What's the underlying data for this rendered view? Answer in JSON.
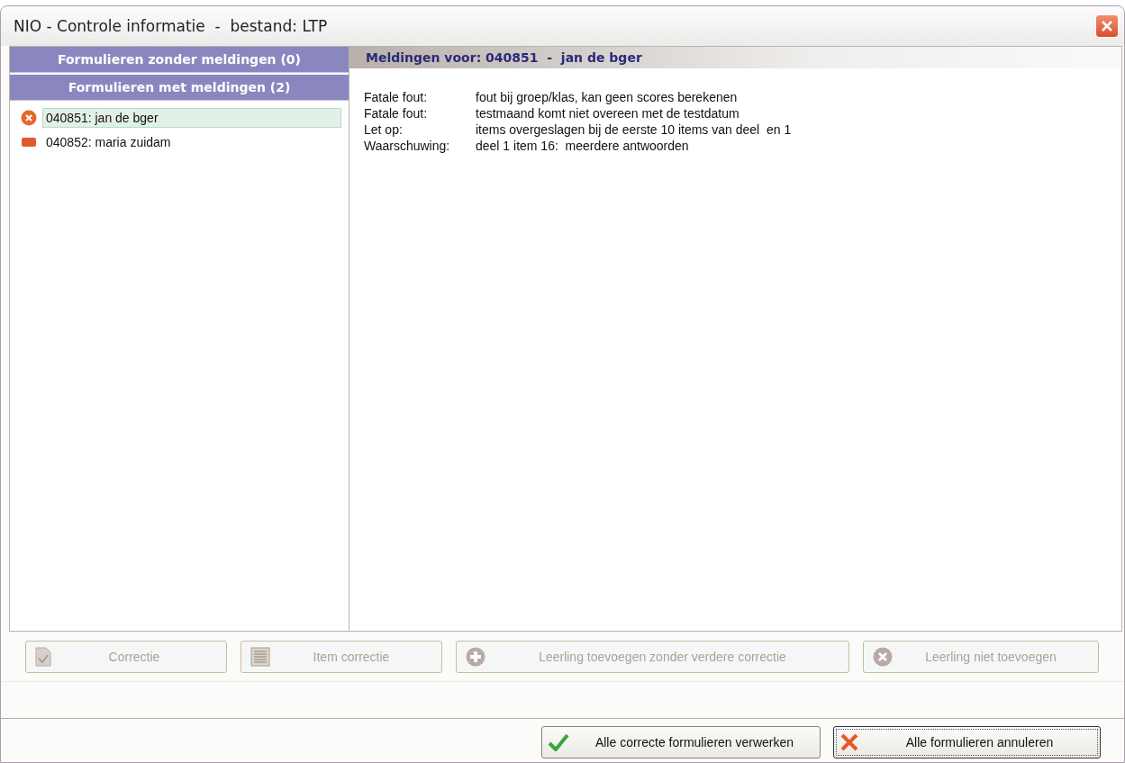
{
  "window": {
    "title": "NIO - Controle informatie  -  bestand: LTP"
  },
  "sidebar": {
    "groups": [
      {
        "label": "Formulieren zonder meldingen (0)"
      },
      {
        "label": "Formulieren met meldingen (2)"
      }
    ],
    "items": [
      {
        "label": "040851: jan de bger",
        "kind": "error",
        "selected": true
      },
      {
        "label": "040852: maria zuidam",
        "kind": "warning",
        "selected": false
      }
    ]
  },
  "details": {
    "header": "Meldingen voor: 040851  -  jan de bger",
    "messages": [
      {
        "type": "Fatale fout:",
        "text": "fout bij groep/klas, kan geen scores berekenen"
      },
      {
        "type": "Fatale fout:",
        "text": "testmaand komt niet overeen met de testdatum"
      },
      {
        "type": "Let op:",
        "text": "items overgeslagen bij de eerste 10 items van deel  en 1"
      },
      {
        "type": "Waarschuwing:",
        "text": "deel 1 item 16:  meerdere antwoorden"
      }
    ]
  },
  "actions": [
    {
      "label": "Correctie",
      "kind": "doc",
      "disabled": true
    },
    {
      "label": "Item correctie",
      "kind": "list",
      "disabled": true
    },
    {
      "label": "Leerling toevoegen zonder verdere correctie",
      "kind": "plus",
      "disabled": true
    },
    {
      "label": "Leerling niet toevoegen",
      "kind": "remove",
      "disabled": true
    }
  ],
  "buttons": [
    {
      "label": "Alle correcte formulieren verwerken",
      "kind": "ok",
      "focused": false
    },
    {
      "label": "Alle formulieren annuleren",
      "kind": "cancel",
      "focused": true
    }
  ]
}
